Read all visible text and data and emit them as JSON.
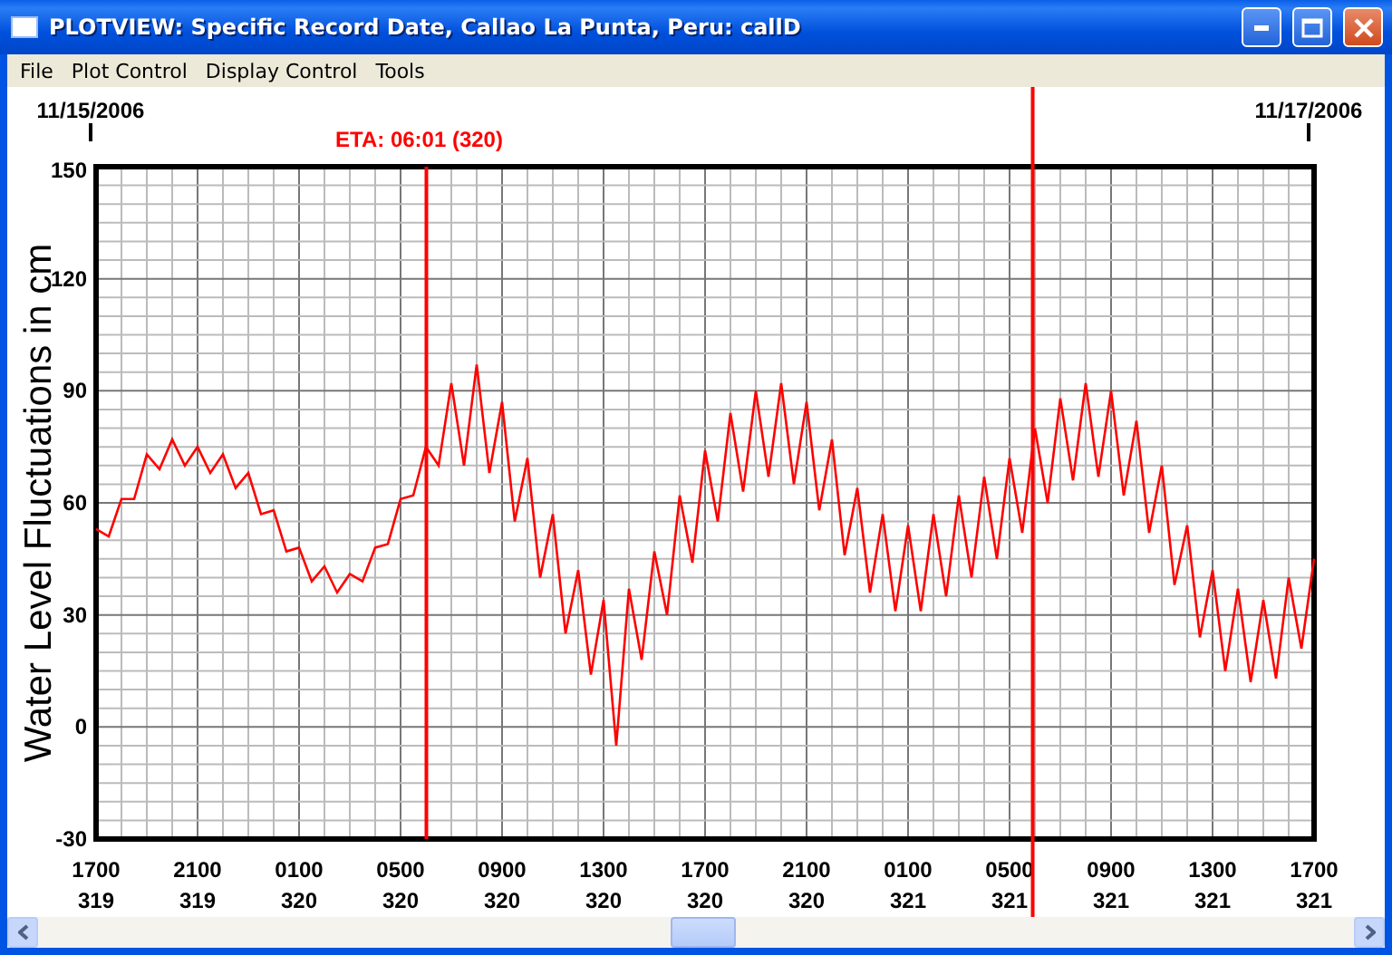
{
  "window": {
    "title": "PLOTVIEW: Specific Record Date, Callao La Punta, Peru: callD"
  },
  "menu": [
    {
      "label": "File"
    },
    {
      "label": "Plot Control"
    },
    {
      "label": "Display Control"
    },
    {
      "label": "Tools"
    }
  ],
  "date_markers": [
    {
      "label": "11/15/2006"
    },
    {
      "label": "11/17/2006"
    }
  ],
  "plot": {
    "chart_data": {
      "type": "line",
      "ylabel": "Water Level Fluctuations in cm",
      "ylim": [
        -30,
        150
      ],
      "yticks": [
        -30,
        0,
        30,
        60,
        90,
        120,
        150
      ],
      "categories": [
        "1700\n319",
        null,
        null,
        null,
        null,
        null,
        null,
        null,
        "2100\n319",
        null,
        null,
        null,
        null,
        null,
        null,
        null,
        "0100\n320",
        null,
        null,
        null,
        null,
        null,
        null,
        null,
        "0500\n320",
        null,
        null,
        null,
        null,
        null,
        null,
        null,
        "0900\n320",
        null,
        null,
        null,
        null,
        null,
        null,
        null,
        "1300\n320",
        null,
        null,
        null,
        null,
        null,
        null,
        null,
        "1700\n320",
        null,
        null,
        null,
        null,
        null,
        null,
        null,
        "2100\n320",
        null,
        null,
        null,
        null,
        null,
        null,
        null,
        "0100\n321",
        null,
        null,
        null,
        null,
        null,
        null,
        null,
        "0500\n321",
        null,
        null,
        null,
        null,
        null,
        null,
        null,
        "0900\n321",
        null,
        null,
        null,
        null,
        null,
        null,
        null,
        "1300\n321",
        null,
        null,
        null,
        null,
        null,
        null,
        null,
        "1700\n321"
      ],
      "series": [
        {
          "color": "#ff0000",
          "values": [
            53,
            51,
            61,
            61,
            73,
            69,
            77,
            70,
            75,
            68,
            73,
            64,
            68,
            57,
            58,
            47,
            48,
            39,
            43,
            36,
            41,
            39,
            48,
            49,
            61,
            62,
            75,
            70,
            92,
            70,
            97,
            68,
            87,
            55,
            72,
            40,
            57,
            25,
            42,
            14,
            34,
            -5,
            37,
            18,
            47,
            30,
            62,
            44,
            74,
            55,
            84,
            63,
            90,
            67,
            92,
            65,
            87,
            58,
            77,
            46,
            64,
            36,
            57,
            31,
            54,
            31,
            57,
            35,
            62,
            40,
            67,
            45,
            72,
            52,
            80,
            60,
            88,
            66,
            92,
            67,
            90,
            62,
            82,
            52,
            70,
            38,
            54,
            24,
            42,
            15,
            37,
            12,
            34,
            13,
            40,
            21,
            45
          ]
        }
      ],
      "grid": true,
      "annotations": [
        "ETA: 06:01 (320)"
      ]
    }
  }
}
